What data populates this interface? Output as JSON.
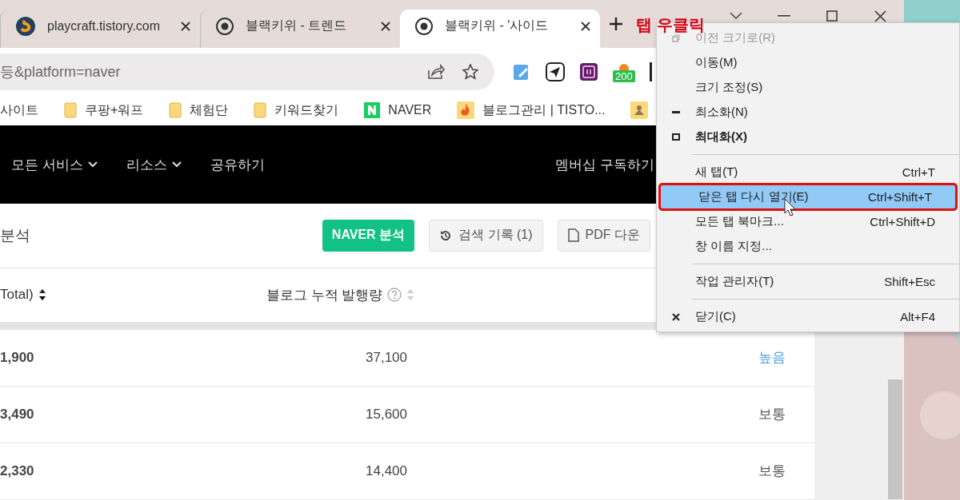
{
  "tabs": [
    {
      "title": "playcraft.tistory.com",
      "kind": "logo",
      "selected": false
    },
    {
      "title": "블랙키위 - 트렌드",
      "kind": "radio",
      "selected": false
    },
    {
      "title": "블랙키위 - '사이드",
      "kind": "radio",
      "selected": true
    }
  ],
  "annotation": "탭 우클릭",
  "address": "등&platform=naver",
  "extension_badge": "200",
  "bookmarks": [
    {
      "label": "사이트",
      "kind": "none"
    },
    {
      "label": "쿠팡+워프",
      "kind": "folder"
    },
    {
      "label": "체험단",
      "kind": "folder"
    },
    {
      "label": "키워드찾기",
      "kind": "folder"
    },
    {
      "label": "NAVER",
      "kind": "naver"
    },
    {
      "label": "블로그관리 | TISTO...",
      "kind": "fire"
    },
    {
      "kind": "site"
    }
  ],
  "nav": {
    "items": [
      {
        "label": "모든 서비스",
        "dropdown": true
      },
      {
        "label": "리소스",
        "dropdown": true
      },
      {
        "label": "공유하기",
        "dropdown": false
      }
    ],
    "member": "멤버십 구독하기"
  },
  "toolbar": {
    "title": "분석",
    "buttons": [
      {
        "label": "NAVER 분석",
        "kind": "primary"
      },
      {
        "label": "검색 기록 (1)",
        "kind": "history"
      },
      {
        "label": "PDF 다운",
        "kind": "pdf"
      }
    ]
  },
  "table": {
    "columns": [
      {
        "label": "Total)",
        "help": false,
        "sorted": true
      },
      {
        "label": "블로그 누적 발행량",
        "help": true,
        "sorted": false
      }
    ],
    "rows": [
      {
        "cells": [
          "1,900",
          "37,100"
        ],
        "grade": "높음",
        "color": "#4a9fe0"
      },
      {
        "cells": [
          "3,490",
          "15,600"
        ],
        "grade": "보통",
        "color": "#555555"
      },
      {
        "cells": [
          "2,330",
          "14,400"
        ],
        "grade": "보통",
        "color": "#555555"
      }
    ]
  },
  "context_menu": {
    "items": [
      {
        "kind": "restore",
        "label": "이전 크기로(R)",
        "disabled": true,
        "selected": false,
        "bold": false
      },
      {
        "kind": "item",
        "label": "이동(M)",
        "disabled": false,
        "selected": false,
        "bold": false
      },
      {
        "kind": "item",
        "label": "크기 조정(S)",
        "disabled": false,
        "selected": false,
        "bold": false
      },
      {
        "kind": "minimize",
        "label": "최소화(N)",
        "disabled": false,
        "selected": false,
        "bold": false
      },
      {
        "kind": "maximize",
        "label": "최대화(X)",
        "disabled": false,
        "selected": false,
        "bold": true
      },
      {
        "kind": "separator"
      },
      {
        "kind": "item",
        "label": "새 탭(T)",
        "shortcut": "Ctrl+T",
        "disabled": false,
        "selected": false,
        "bold": false
      },
      {
        "kind": "item",
        "label": "닫은 탭 다시 열기(E)",
        "shortcut": "Ctrl+Shift+T",
        "disabled": false,
        "selected": true,
        "bold": false
      },
      {
        "kind": "item",
        "label": "모든 탭 북마크...",
        "shortcut": "Ctrl+Shift+D",
        "disabled": false,
        "selected": false,
        "bold": false
      },
      {
        "kind": "item",
        "label": "창 이름 지정...",
        "disabled": false,
        "selected": false,
        "bold": false
      },
      {
        "kind": "separator"
      },
      {
        "kind": "item",
        "label": "작업 관리자(T)",
        "shortcut": "Shift+Esc",
        "disabled": false,
        "selected": false,
        "bold": false
      },
      {
        "kind": "separator"
      },
      {
        "kind": "close",
        "label": "닫기(C)",
        "shortcut": "Alt+F4",
        "disabled": false,
        "selected": false,
        "bold": false
      }
    ]
  }
}
